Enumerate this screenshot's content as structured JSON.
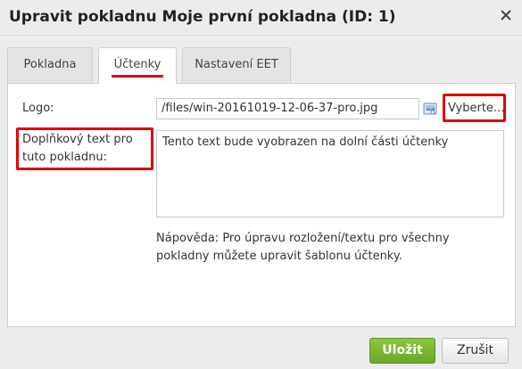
{
  "dialog": {
    "title": "Upravit pokladnu Moje první pokladna (ID: 1)",
    "close_icon": "close-x-icon"
  },
  "tabs": [
    {
      "label": "Pokladna",
      "active": false
    },
    {
      "label": "Účtenky",
      "active": true
    },
    {
      "label": "Nastavení EET",
      "active": false
    }
  ],
  "form": {
    "logo_label": "Logo:",
    "logo_value": "/files/win-20161019-12-06-37-pro.jpg",
    "browse_icon": "image-browse-icon",
    "choose_label": "Vyberte...",
    "extra_text_label": "Doplňkový text pro tuto pokladnu:",
    "extra_text_value": "Tento text bude vyobrazen na dolní části účtenky",
    "help_text": "Nápověda: Pro úpravu rozložení/textu pro všechny pokladny můžete upravit šablonu účtenky."
  },
  "footer": {
    "save_label": "Uložit",
    "cancel_label": "Zrušit"
  },
  "colors": {
    "highlight": "#e00000",
    "save_green": "#7ab833"
  }
}
